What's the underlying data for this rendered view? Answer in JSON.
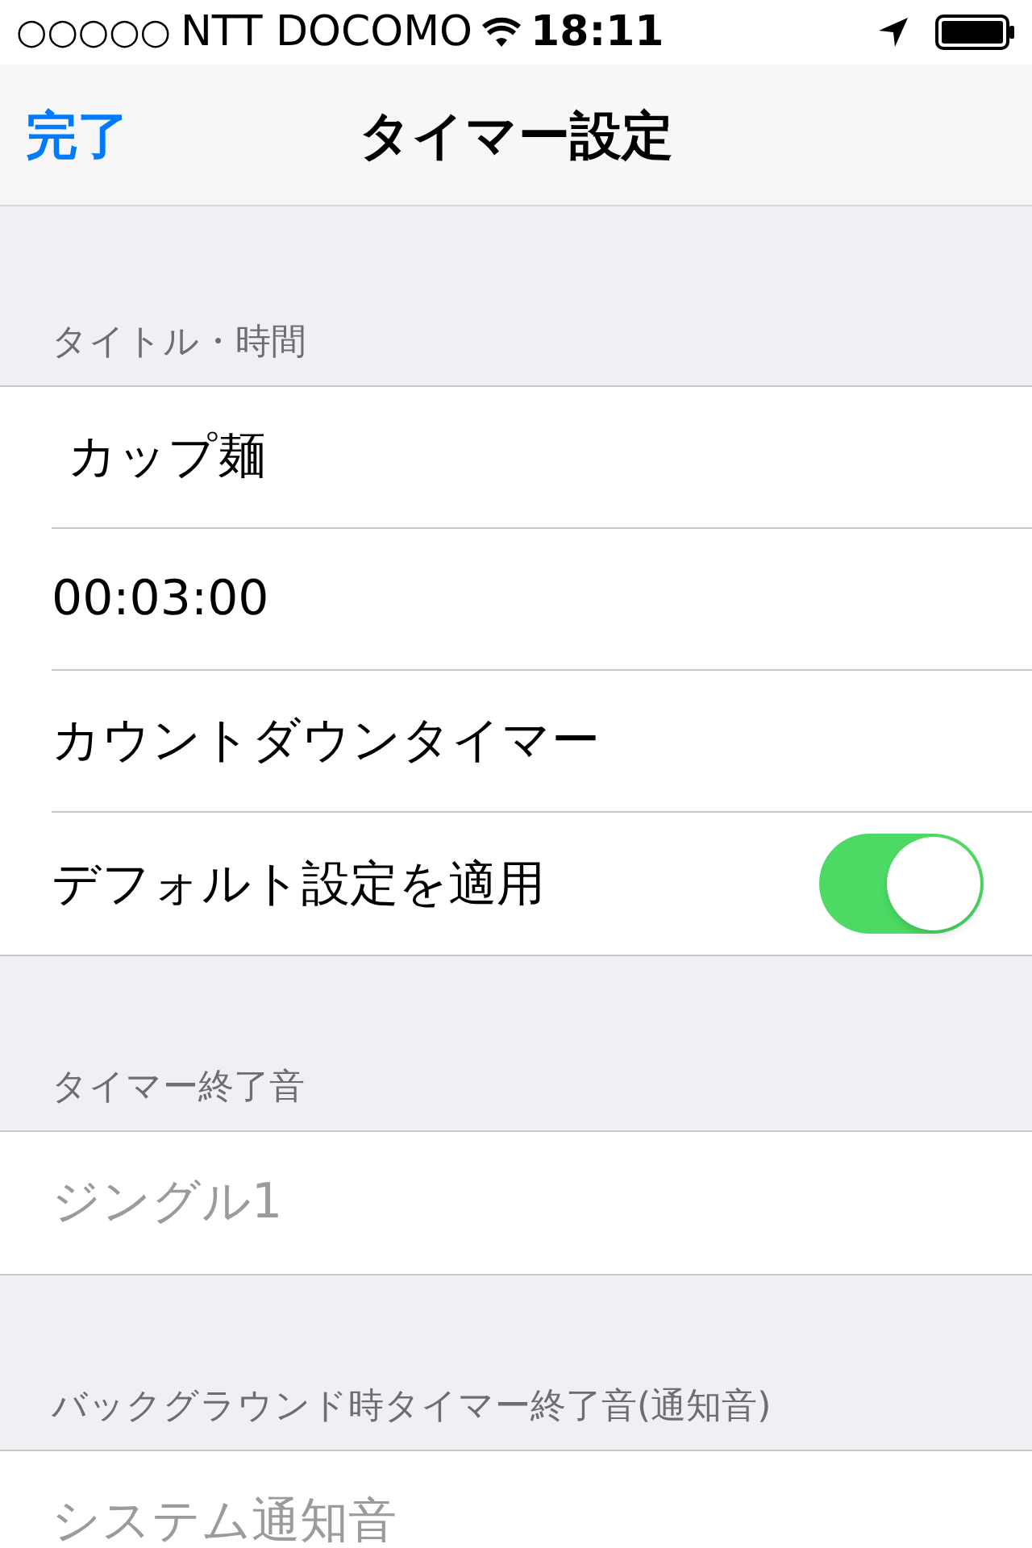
{
  "status_bar": {
    "signal": "○○○○○",
    "carrier": "NTT DOCOMO",
    "time": "18:11"
  },
  "nav_bar": {
    "done_button": "完了",
    "title": "タイマー設定"
  },
  "sections": [
    {
      "header": "タイトル・時間",
      "rows": [
        {
          "kind": "field",
          "value": "カップ麺"
        },
        {
          "kind": "text",
          "label": "00:03:00"
        },
        {
          "kind": "text",
          "label": "カウントダウンタイマー"
        },
        {
          "kind": "toggle",
          "label": "デフォルト設定を適用",
          "on": true
        }
      ]
    },
    {
      "header": "タイマー終了音",
      "rows": [
        {
          "kind": "value",
          "label": "ジングル1"
        }
      ]
    },
    {
      "header": "バックグラウンド時タイマー終了音(通知音)",
      "rows": [
        {
          "kind": "value",
          "label": "システム通知音"
        }
      ]
    }
  ]
}
